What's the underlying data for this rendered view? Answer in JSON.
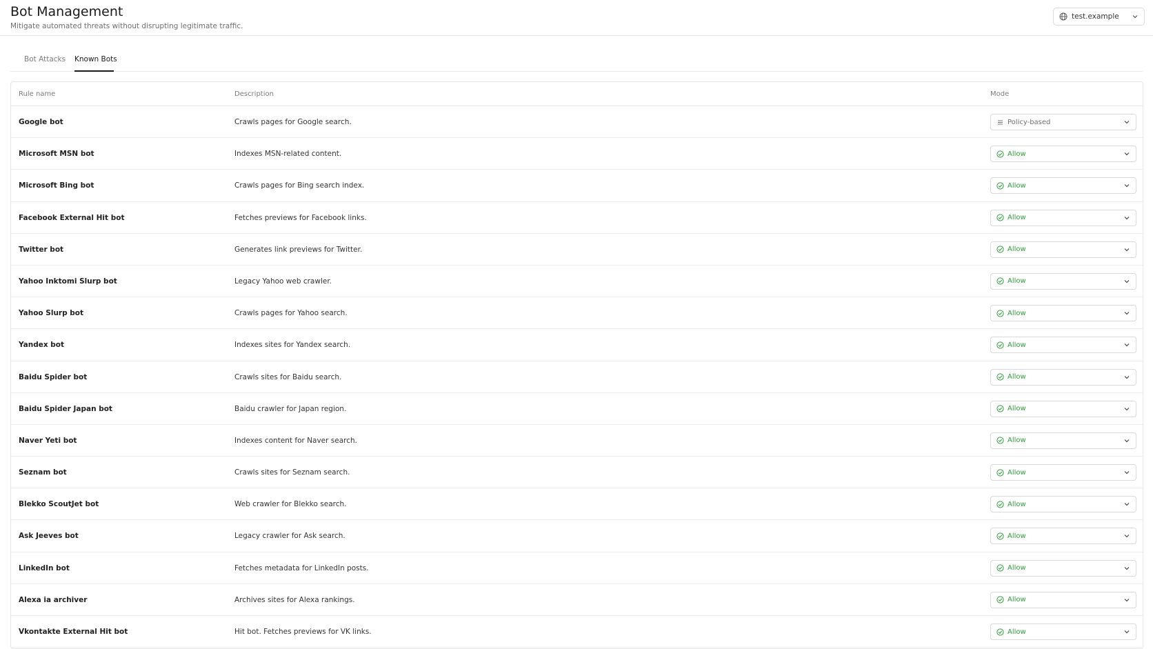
{
  "header": {
    "title": "Bot Management",
    "subtitle": "Mitigate automated threats without disrupting legitimate traffic.",
    "zone_selector": {
      "label": "test.example",
      "icon": "globe-icon"
    }
  },
  "tabs": [
    {
      "label": "Bot Attacks",
      "active": false
    },
    {
      "label": "Known Bots",
      "active": true
    }
  ],
  "table": {
    "columns": {
      "name": "Rule name",
      "description": "Description",
      "mode": "Mode"
    },
    "rows": [
      {
        "name": "Google bot",
        "description": "Crawls pages for Google search.",
        "mode": "Policy-based"
      },
      {
        "name": "Microsoft MSN bot",
        "description": "Indexes MSN-related content.",
        "mode": "Allow"
      },
      {
        "name": "Microsoft Bing bot",
        "description": "Crawls pages for Bing search index.",
        "mode": "Allow"
      },
      {
        "name": "Facebook External Hit bot",
        "description": "Fetches previews for Facebook links.",
        "mode": "Allow"
      },
      {
        "name": "Twitter bot",
        "description": "Generates link previews for Twitter.",
        "mode": "Allow"
      },
      {
        "name": "Yahoo Inktomi Slurp bot",
        "description": "Legacy Yahoo web crawler.",
        "mode": "Allow"
      },
      {
        "name": "Yahoo Slurp bot",
        "description": "Crawls pages for Yahoo search.",
        "mode": "Allow"
      },
      {
        "name": "Yandex bot",
        "description": "Indexes sites for Yandex search.",
        "mode": "Allow"
      },
      {
        "name": "Baidu Spider bot",
        "description": "Crawls sites for Baidu search.",
        "mode": "Allow"
      },
      {
        "name": "Baidu Spider Japan bot",
        "description": "Baidu crawler for Japan region.",
        "mode": "Allow"
      },
      {
        "name": "Naver Yeti bot",
        "description": "Indexes content for Naver search.",
        "mode": "Allow"
      },
      {
        "name": "Seznam bot",
        "description": "Crawls sites for Seznam search.",
        "mode": "Allow"
      },
      {
        "name": "Blekko ScoutJet bot",
        "description": "Web crawler for Blekko search.",
        "mode": "Allow"
      },
      {
        "name": "Ask Jeeves bot",
        "description": "Legacy crawler for Ask search.",
        "mode": "Allow"
      },
      {
        "name": "LinkedIn bot",
        "description": "Fetches metadata for LinkedIn posts.",
        "mode": "Allow"
      },
      {
        "name": "Alexa ia archiver",
        "description": "Archives sites for Alexa rankings.",
        "mode": "Allow"
      },
      {
        "name": "Vkontakte External Hit bot",
        "description": "Hit bot. Fetches previews for VK links.",
        "mode": "Allow"
      }
    ]
  },
  "colors": {
    "allow": "#2e9e3a",
    "policy": "#6e6e6e",
    "border": "#e6e6e6"
  }
}
